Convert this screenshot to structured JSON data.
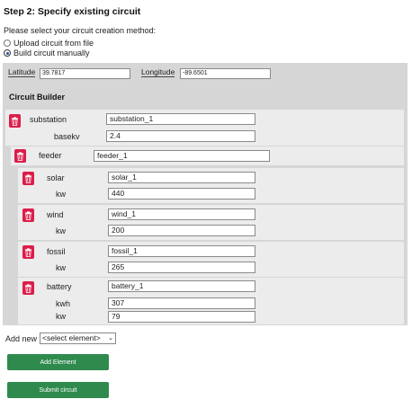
{
  "header": {
    "step_title": "Step 2: Specify existing circuit",
    "prompt": "Please select your circuit creation method:"
  },
  "methods": [
    {
      "label": "Upload circuit from file",
      "selected": false
    },
    {
      "label": "Build circuit manually",
      "selected": true
    }
  ],
  "coordinates": {
    "latitude_label": "Latitude",
    "latitude_value": "39.7817",
    "longitude_label": "Longitude",
    "longitude_value": "-89.6501"
  },
  "builder": {
    "title": "Circuit Builder",
    "elements": [
      {
        "type": "substation",
        "name": "substation_1",
        "fields": [
          {
            "label": "basekv",
            "value": "2.4"
          }
        ]
      },
      {
        "type": "feeder",
        "name": "feeder_1",
        "fields": []
      },
      {
        "type": "solar",
        "name": "solar_1",
        "fields": [
          {
            "label": "kw",
            "value": "440"
          }
        ]
      },
      {
        "type": "wind",
        "name": "wind_1",
        "fields": [
          {
            "label": "kw",
            "value": "200"
          }
        ]
      },
      {
        "type": "fossil",
        "name": "fossil_1",
        "fields": [
          {
            "label": "kw",
            "value": "265"
          }
        ]
      },
      {
        "type": "battery",
        "name": "battery_1",
        "fields": [
          {
            "label": "kwh",
            "value": "307"
          },
          {
            "label": "kw",
            "value": "79"
          }
        ]
      }
    ]
  },
  "add_new": {
    "label": "Add new",
    "selected_option": "<select element>"
  },
  "buttons": {
    "add_element": "Add Element",
    "submit": "Submit circuit"
  },
  "colors": {
    "delete": "#dc1d4a",
    "button": "#2f8a4e",
    "builder_bg": "#d6d6d6",
    "panel_bg": "#ececec"
  },
  "icons": {
    "delete": "trash-icon"
  }
}
